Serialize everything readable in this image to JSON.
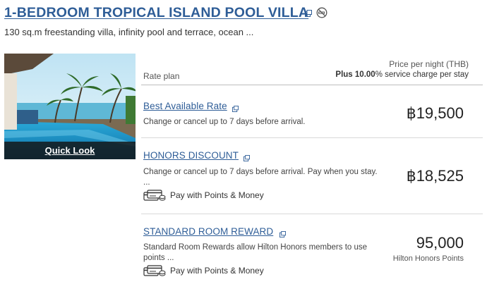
{
  "room": {
    "title": "1-BEDROOM TROPICAL ISLAND POOL VILLA",
    "description": "130 sq.m freestanding villa, infinity pool and terrace, ocean ...",
    "quick_look_label": "Quick Look",
    "title_icons": [
      "external-link-icon",
      "no-smoking-icon"
    ]
  },
  "table_header": {
    "rate_plan": "Rate plan",
    "price_per_night": "Price per night (THB)",
    "service_prefix": "Plus",
    "service_percent": "10.00",
    "service_suffix": "% service charge per stay"
  },
  "rates": [
    {
      "name": "Best Available Rate",
      "description": "Change or cancel up to 7 days before arrival.",
      "price": "฿19,500"
    },
    {
      "name": "HONORS DISCOUNT",
      "description": "Change or cancel up to 7 days before arrival. Pay when you stay.",
      "description_more": "...",
      "price": "฿18,525",
      "payment_option": "Pay with Points & Money"
    },
    {
      "name": "STANDARD ROOM REWARD",
      "description": "Standard Room Rewards allow Hilton Honors members to use",
      "description_more": "points ...",
      "price": "95,000",
      "price_unit": "Hilton Honors Points",
      "payment_option": "Pay with Points & Money"
    }
  ],
  "colors": {
    "link": "#2e5d97",
    "text": "#333333",
    "divider": "#d9d9d9"
  }
}
